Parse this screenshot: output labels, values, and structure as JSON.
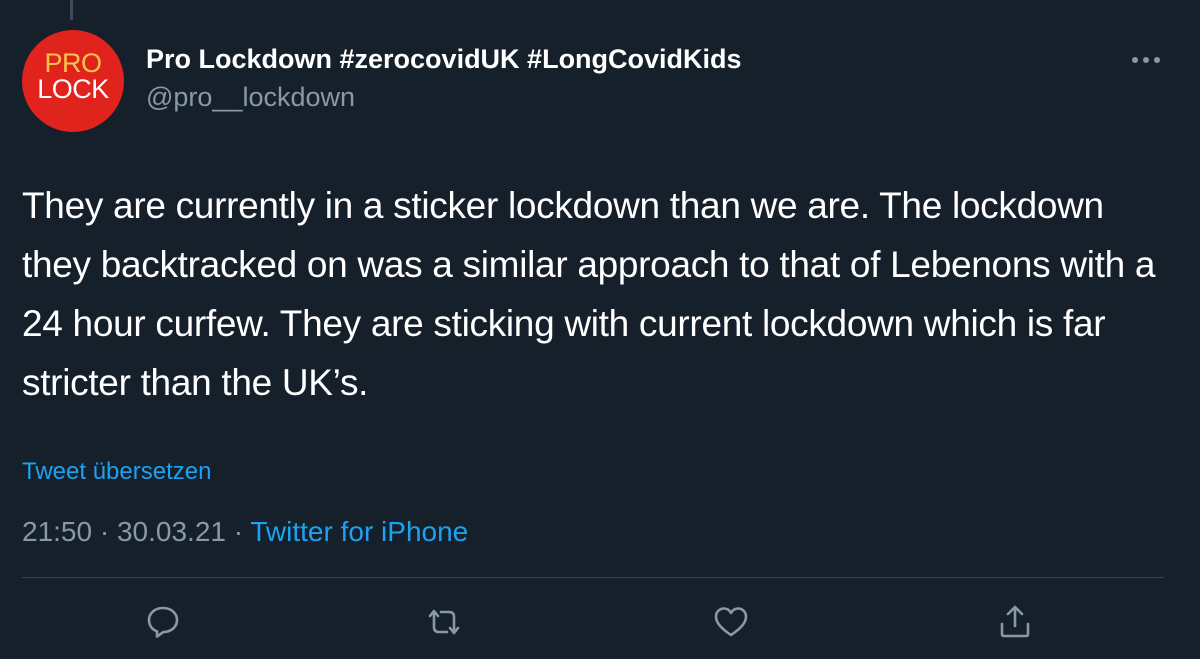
{
  "avatar": {
    "line1": "PRO",
    "line2": "LOCK",
    "bg_color": "#e0231d"
  },
  "header": {
    "display_name": "Pro Lockdown #zerocovidUK #LongCovidKids",
    "handle": "@pro__lockdown"
  },
  "tweet": {
    "text": "They are currently in a sticker lockdown than we are. The lockdown they backtracked on was a similar approach to that of Lebenons with a 24 hour curfew. They are sticking with current lockdown which is far stricter than the UK’s.",
    "translate_label": "Tweet übersetzen",
    "time": "21:50",
    "separator": " · ",
    "date": "30.03.21",
    "source": "Twitter for iPhone"
  },
  "actions": {
    "icons": [
      "reply-icon",
      "retweet-icon",
      "like-icon",
      "share-icon"
    ]
  },
  "colors": {
    "background": "#15202b",
    "text": "#ffffff",
    "secondary": "#8899a6",
    "accent": "#1da1f2",
    "divider": "#38444d"
  }
}
